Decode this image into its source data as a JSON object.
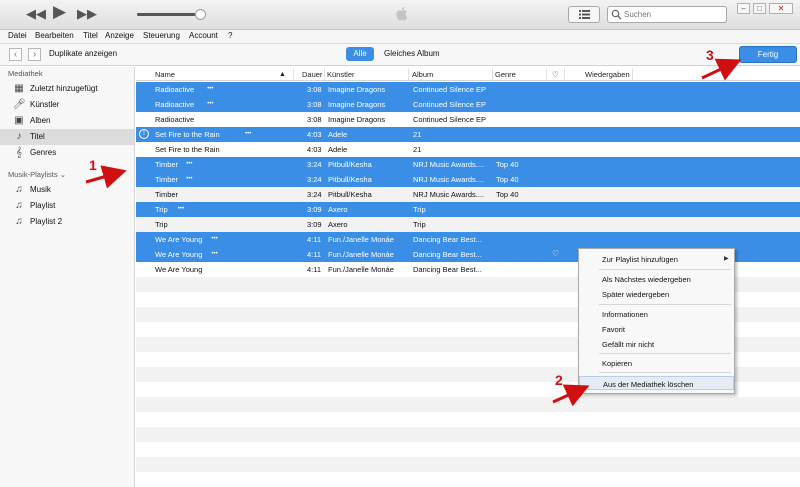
{
  "search": {
    "placeholder": "Suchen"
  },
  "menubar": [
    "Datei",
    "Bearbeiten",
    "Titel",
    "Anzeige",
    "Steuerung",
    "Account",
    "?"
  ],
  "navbar": {
    "duplicates_label": "Duplikate anzeigen",
    "segment_all": "Alle",
    "segment_same_album": "Gleiches Album",
    "done_button": "Fertig"
  },
  "sidebar": {
    "library_heading": "Mediathek",
    "library_items": [
      {
        "label": "Zuletzt hinzugefügt",
        "icon": "calendar-icon"
      },
      {
        "label": "Künstler",
        "icon": "microphone-icon"
      },
      {
        "label": "Alben",
        "icon": "album-icon"
      },
      {
        "label": "Titel",
        "icon": "music-note-icon"
      },
      {
        "label": "Genres",
        "icon": "genres-icon"
      }
    ],
    "playlists_heading": "Musik-Playlists",
    "playlist_items": [
      {
        "label": "Musik",
        "icon": "playlist-icon"
      },
      {
        "label": "Playlist",
        "icon": "playlist-icon"
      },
      {
        "label": "Playlist 2",
        "icon": "playlist-icon"
      }
    ]
  },
  "table": {
    "headers": {
      "name": "Name",
      "duration": "Dauer",
      "artist": "Künstler",
      "album": "Album",
      "genre": "Genre",
      "plays": "Wiedergaben"
    },
    "rows": [
      {
        "name": "Radioactive",
        "dots": "•••",
        "duration": "3:08",
        "artist": "Imagine Dragons",
        "album": "Continued Silence EP",
        "genre": "",
        "selected": true
      },
      {
        "name": "Radioactive",
        "dots": "•••",
        "duration": "3:08",
        "artist": "Imagine Dragons",
        "album": "Continued Silence EP",
        "genre": "",
        "selected": true
      },
      {
        "name": "Radioactive",
        "dots": "",
        "duration": "3:08",
        "artist": "Imagine Dragons",
        "album": "Continued Silence EP",
        "genre": "",
        "selected": false
      },
      {
        "name": "Set Fire to the Rain",
        "dots": "•••",
        "duration": "4:03",
        "artist": "Adele",
        "album": "21",
        "genre": "",
        "selected": true,
        "warning": "!"
      },
      {
        "name": "Set Fire to the Rain",
        "dots": "",
        "duration": "4:03",
        "artist": "Adele",
        "album": "21",
        "genre": "",
        "selected": false
      },
      {
        "name": "Timber",
        "dots": "•••",
        "duration": "3:24",
        "artist": "Pitbull/Kesha",
        "album": "NRJ Music Awards....",
        "genre": "Top 40",
        "selected": true
      },
      {
        "name": "Timber",
        "dots": "•••",
        "duration": "3:24",
        "artist": "Pitbull/Kesha",
        "album": "NRJ Music Awards....",
        "genre": "Top 40",
        "selected": true
      },
      {
        "name": "Timber",
        "dots": "",
        "duration": "3:24",
        "artist": "Pitbull/Kesha",
        "album": "NRJ Music Awards....",
        "genre": "Top 40",
        "selected": false
      },
      {
        "name": "Trip",
        "dots": "•••",
        "duration": "3:09",
        "artist": "Axero",
        "album": "Trip",
        "genre": "",
        "selected": true
      },
      {
        "name": "Trip",
        "dots": "",
        "duration": "3:09",
        "artist": "Axero",
        "album": "Trip",
        "genre": "",
        "selected": false
      },
      {
        "name": "We Are Young",
        "dots": "•••",
        "duration": "4:11",
        "artist": "Fun./Janelle Monáe",
        "album": "Dancing Bear Best...",
        "genre": "",
        "selected": true
      },
      {
        "name": "We Are Young",
        "dots": "•••",
        "duration": "4:11",
        "artist": "Fun./Janelle Monáe",
        "album": "Dancing Bear Best...",
        "genre": "",
        "selected": true,
        "heart": "♡"
      },
      {
        "name": "We Are Young",
        "dots": "",
        "duration": "4:11",
        "artist": "Fun./Janelle Monáe",
        "album": "Dancing Bear Best...",
        "genre": "",
        "selected": false
      }
    ],
    "empty_rows": 13
  },
  "context_menu": [
    {
      "label": "Zur Playlist hinzufügen",
      "submenu": true
    },
    {
      "label": "Als Nächstes wiedergeben"
    },
    {
      "label": "Später wiedergeben"
    },
    {
      "label": "Informationen"
    },
    {
      "label": "Favorit"
    },
    {
      "label": "Gefällt mir nicht"
    },
    {
      "label": "Kopieren"
    },
    {
      "label": "Aus der Mediathek löschen",
      "highlighted": true
    }
  ],
  "annotations": {
    "n1": "1",
    "n2": "2",
    "n3": "3"
  },
  "colors": {
    "selection": "#3a8ee6",
    "annotation": "#d01010",
    "row_alt": "#f2f2f2"
  }
}
